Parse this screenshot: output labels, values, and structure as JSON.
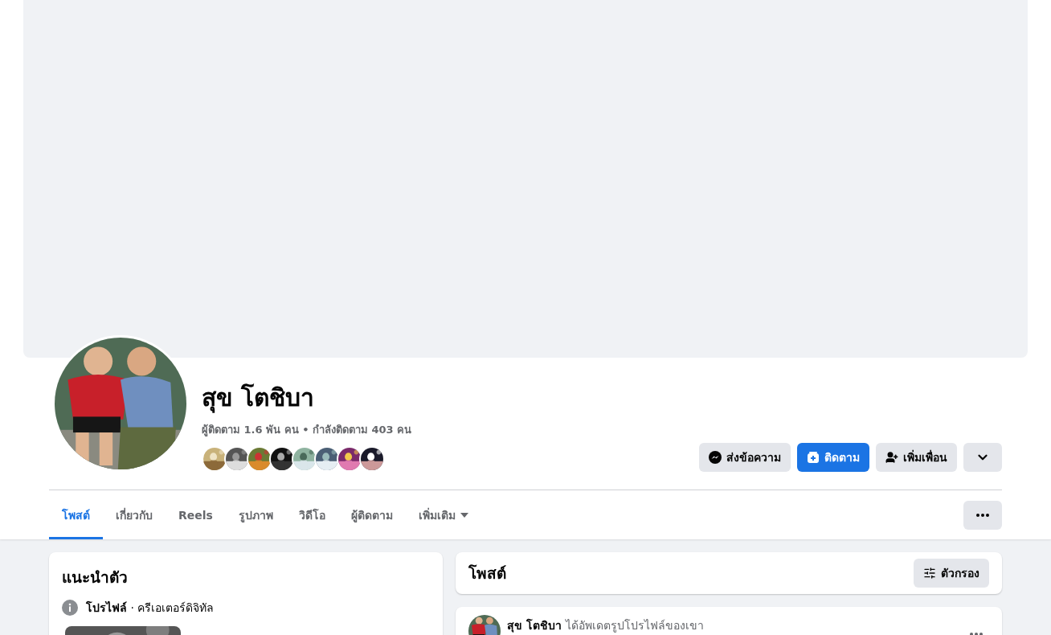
{
  "profile": {
    "name": "สุข โตชิบา",
    "stats": "ผู้ติดตาม 1.6 พัน คน • กำลังติดตาม 403 คน"
  },
  "actions": [
    {
      "kind": "message",
      "label": "ส่งข้อความ"
    },
    {
      "kind": "follow",
      "label": "ติดตาม"
    },
    {
      "kind": "add_friend",
      "label": "เพิ่มเพื่อน"
    },
    {
      "kind": "menu"
    }
  ],
  "tabs": [
    {
      "label": "โพสต์",
      "selected": true,
      "kind": "tab"
    },
    {
      "label": "เกี่ยวกับ",
      "selected": false,
      "kind": "tab"
    },
    {
      "label": "Reels",
      "selected": false,
      "kind": "tab"
    },
    {
      "label": "รูปภาพ",
      "selected": false,
      "kind": "tab"
    },
    {
      "label": "วิดีโอ",
      "selected": false,
      "kind": "tab"
    },
    {
      "label": "ผู้ติดตาม",
      "selected": false,
      "kind": "tab"
    },
    {
      "label": "เพิ่มเติม",
      "selected": false,
      "kind": "dropdown"
    }
  ],
  "intro": {
    "title": "แนะนำตัว",
    "items": [
      {
        "text": "**โปรไฟล์** · ครีเอเตอร์ดิจิทัล"
      }
    ]
  },
  "posts": {
    "title": "โพสต์",
    "filter_label": "ตัวกรอง",
    "items": [
      {
        "author": "สุข โตชิบา",
        "action": "ได้อัพเดตรูปโปรไฟล์ของเขา"
      }
    ]
  }
}
